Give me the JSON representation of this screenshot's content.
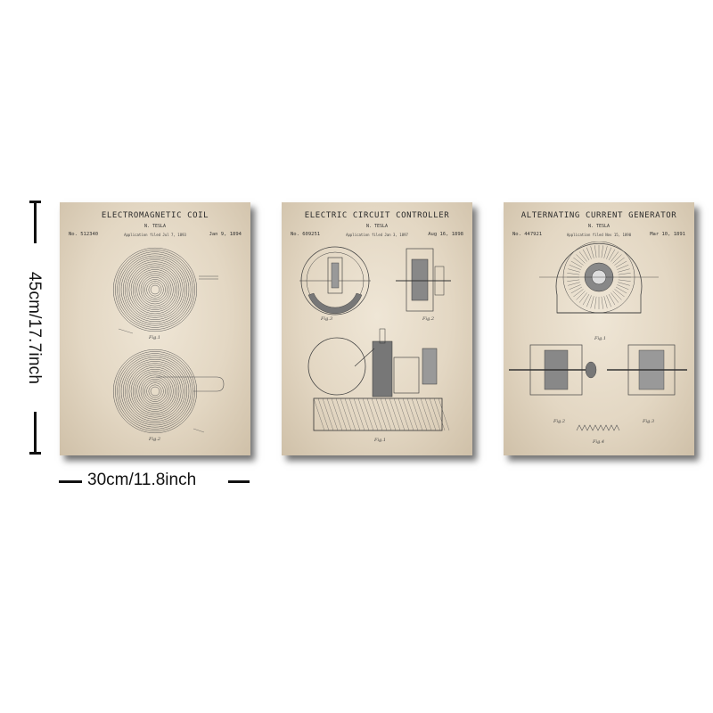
{
  "dimensions": {
    "height_label": "45cm/17.7inch",
    "width_label": "30cm/11.8inch"
  },
  "posters": [
    {
      "title": "ELECTROMAGNETIC COIL",
      "inventor": "N. TESLA",
      "number": "No. 512340",
      "filed": "Application filed Jul 7, 1893",
      "date": "Jan 9, 1894",
      "figures": [
        "Fig.1",
        "Fig.2"
      ]
    },
    {
      "title": "ELECTRIC CIRCUIT CONTROLLER",
      "inventor": "N. TESLA",
      "number": "No. 609251",
      "filed": "Application filed Jan 3, 1897",
      "date": "Aug 16, 1898",
      "figures": [
        "Fig.3",
        "Fig.2",
        "Fig.1"
      ]
    },
    {
      "title": "ALTERNATING CURRENT GENERATOR",
      "inventor": "N. TESLA",
      "number": "No. 447921",
      "filed": "Application filed Nov 15, 1890",
      "date": "Mar 10, 1891",
      "figures": [
        "Fig.1",
        "Fig.2",
        "Fig.3",
        "Fig.4"
      ]
    }
  ],
  "colors": {
    "paper": "#e6dccb",
    "ink": "#3a3a3a",
    "marker": "#111111"
  }
}
